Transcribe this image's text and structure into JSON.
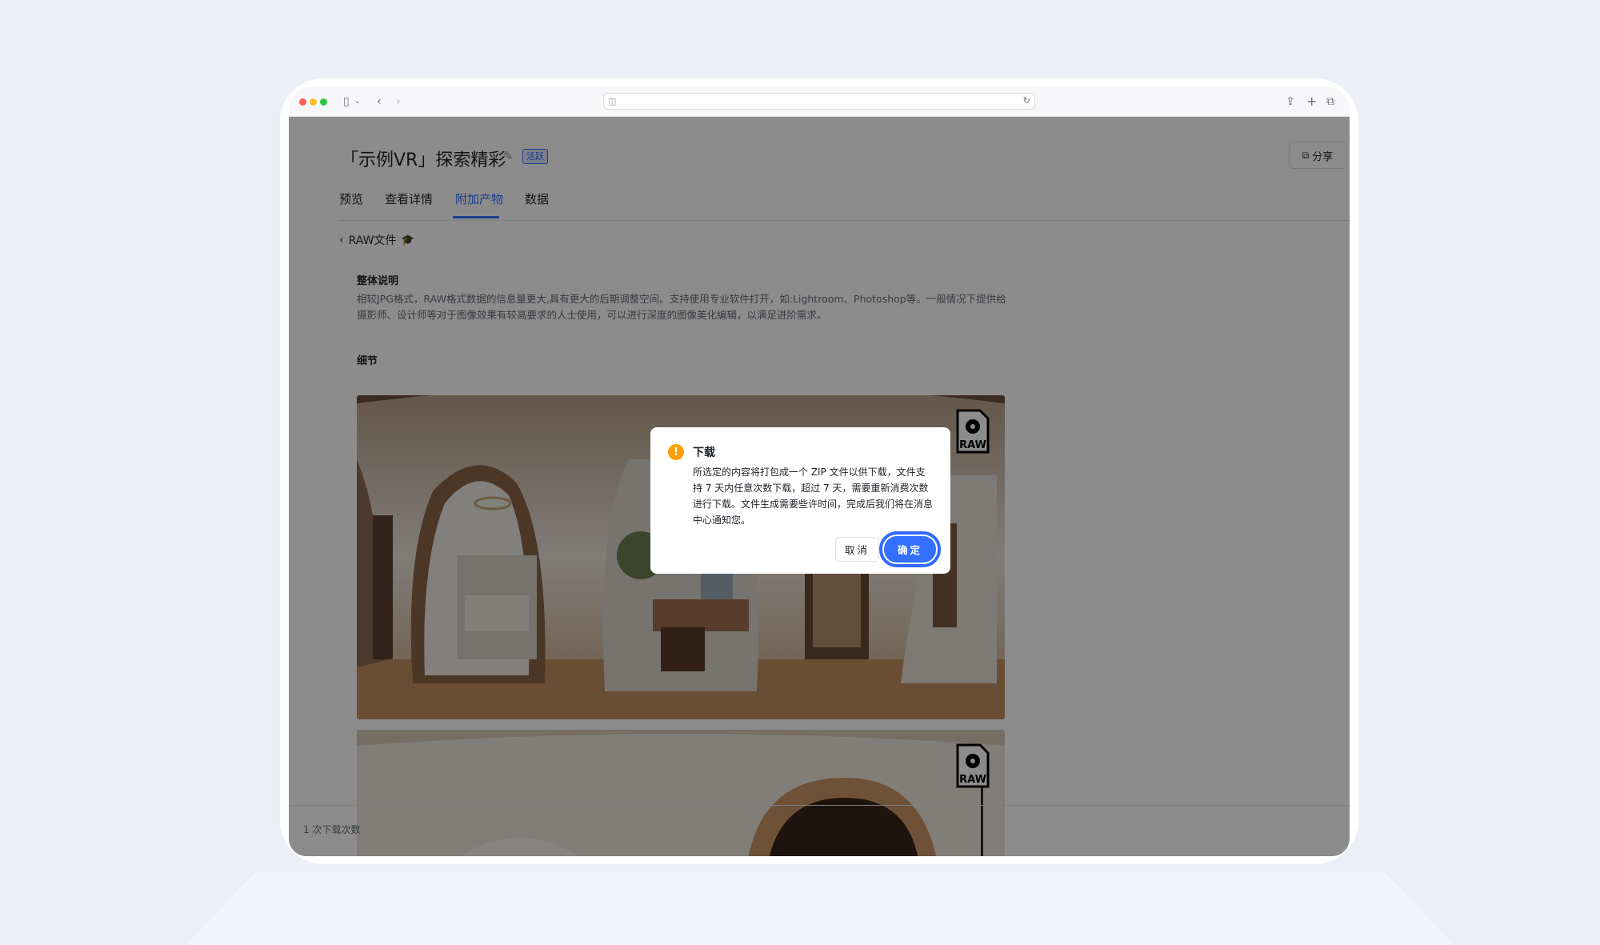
{
  "page": {
    "title": "「示例VR」探索精彩",
    "status_tag": "活跃",
    "share_label": "分享"
  },
  "tabs": [
    {
      "label": "预览"
    },
    {
      "label": "查看详情"
    },
    {
      "label": "附加产物",
      "active": true
    },
    {
      "label": "数据"
    }
  ],
  "back": {
    "label": "RAW文件"
  },
  "overview": {
    "heading": "整体说明",
    "line1": "相较JPG格式，RAW格式数据的信息量更大,具有更大的后期调整空间。支持使用专业软件打开，如:Lightroom、Photoshop等。一般情况下提供给",
    "line2": "摄影师、设计师等对于图像效果有较高要求的人士使用，可以进行深度的图像美化编辑，以满足进阶需求。"
  },
  "details": {
    "heading": "细节",
    "badge_text": "RAW"
  },
  "footer": {
    "download_count": "1 次下载次数"
  },
  "modal": {
    "title": "下载",
    "body": "所选定的内容将打包成一个 ZIP 文件以供下载，文件支持 7 天内任意次数下载，超过 7 天，需要重新消费次数进行下载。文件生成需要些许时间，完成后我们将在消息中心通知您。",
    "cancel_label": "取消",
    "ok_label": "确定"
  },
  "colors": {
    "accent": "#3370ff",
    "warning": "#FF9F0A",
    "background": "#ECEFF8"
  }
}
